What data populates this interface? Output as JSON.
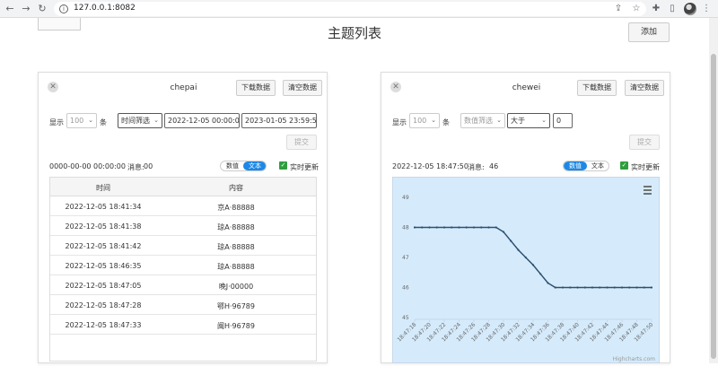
{
  "browser": {
    "url": "127.0.0.1:8082"
  },
  "page": {
    "title": "主题列表",
    "add_label": "添加"
  },
  "panels": [
    {
      "name": "chepai",
      "download_label": "下载数据",
      "clear_label": "清空数据",
      "show_label": "显示",
      "count_value": "100",
      "count_unit": "条",
      "filter_type": "时间筛选",
      "start_time": "2022-12-05 00:00:00",
      "end_time": "2023-01-05 23:59:59",
      "submit_label": "提交",
      "status_time": "0000-00-00 00:00:00",
      "status_msg_label": "消息:",
      "status_msg_count": "00",
      "view_numeric": "数值",
      "view_text": "文本",
      "active_view": "text",
      "realtime_label": "实时更新",
      "table": {
        "headers": [
          "时间",
          "内容"
        ],
        "rows": [
          [
            "2022-12-05 18:41:34",
            "京A·88888"
          ],
          [
            "2022-12-05 18:41:38",
            "琼A·88888"
          ],
          [
            "2022-12-05 18:41:42",
            "琼A·88888"
          ],
          [
            "2022-12-05 18:46:35",
            "琼A·88888"
          ],
          [
            "2022-12-05 18:47:05",
            "晚J·00000"
          ],
          [
            "2022-12-05 18:47:28",
            "鄂H·96789"
          ],
          [
            "2022-12-05 18:47:33",
            "闽H·96789"
          ]
        ]
      }
    },
    {
      "name": "chewei",
      "download_label": "下载数据",
      "clear_label": "清空数据",
      "show_label": "显示",
      "count_value": "100",
      "count_unit": "条",
      "filter_type": "数值筛选",
      "operator": "大于",
      "threshold": "0",
      "submit_label": "提交",
      "status_time": "2022-12-05 18:47:50",
      "status_msg_label": "消息:",
      "status_msg_count": "46",
      "view_numeric": "数值",
      "view_text": "文本",
      "active_view": "numeric",
      "realtime_label": "实时更新",
      "credit": "Highcharts.com"
    }
  ],
  "chart_data": {
    "type": "line",
    "title": "",
    "xlabel": "",
    "ylabel": "",
    "ylim": [
      45,
      49
    ],
    "yticks": [
      45,
      46,
      47,
      48,
      49
    ],
    "x": [
      "18:47:18",
      "18:47:19",
      "18:47:20",
      "18:47:21",
      "18:47:22",
      "18:47:23",
      "18:47:24",
      "18:47:25",
      "18:47:26",
      "18:47:27",
      "18:47:28",
      "18:47:29",
      "18:47:30",
      "18:47:31",
      "18:47:32",
      "18:47:33",
      "18:47:34",
      "18:47:35",
      "18:47:36",
      "18:47:37",
      "18:47:38",
      "18:47:39",
      "18:47:40",
      "18:47:41",
      "18:47:42",
      "18:47:43",
      "18:47:44",
      "18:47:45",
      "18:47:46",
      "18:47:47",
      "18:47:48",
      "18:47:49",
      "18:47:50"
    ],
    "xtick_labels": [
      "18:47:18",
      "18:47:20",
      "18:47:22",
      "18:47:24",
      "18:47:26",
      "18:47:28",
      "18:47:30",
      "18:47:32",
      "18:47:34",
      "18:47:36",
      "18:47:38",
      "18:47:40",
      "18:47:42",
      "18:47:44",
      "18:47:46",
      "18:47:48",
      "18:47:50"
    ],
    "series": [
      {
        "color": "#2f4f6f",
        "values": [
          48,
          48,
          48,
          48,
          48,
          48,
          48,
          48,
          48,
          48,
          48,
          48,
          47.85,
          47.55,
          47.25,
          47.0,
          46.75,
          46.45,
          46.15,
          46.0,
          46,
          46,
          46,
          46,
          46,
          46,
          46,
          46,
          46,
          46,
          46,
          46,
          46
        ]
      }
    ],
    "grid": false,
    "legend": "none"
  }
}
